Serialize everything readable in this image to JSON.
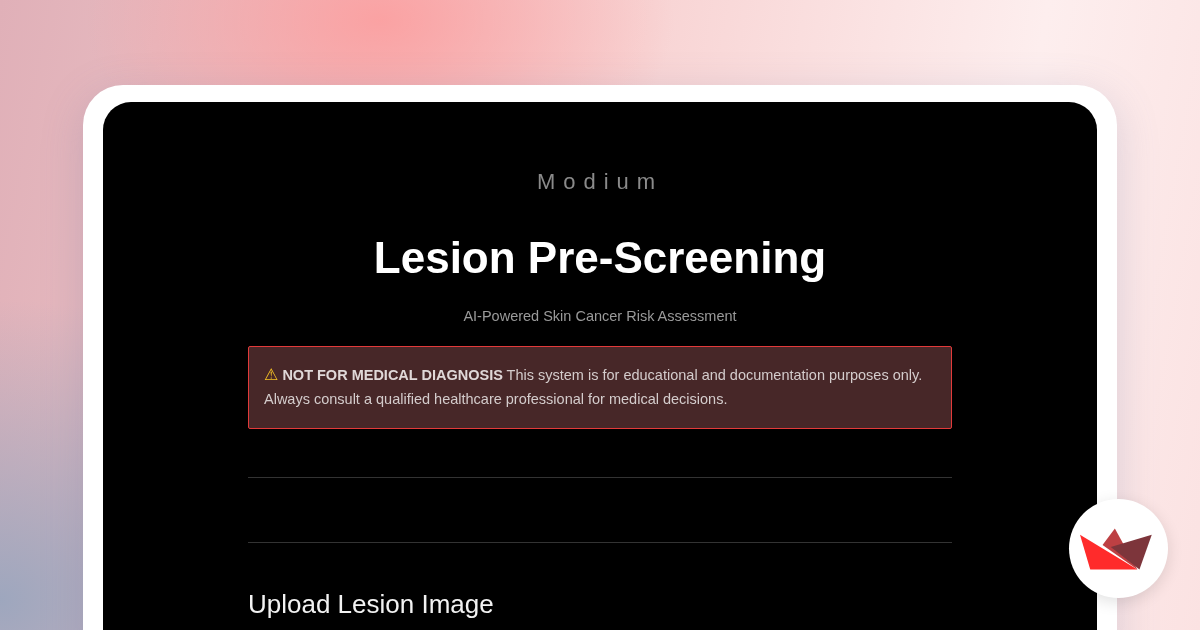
{
  "app": {
    "brand": "Modium",
    "title": "Lesion Pre-Screening",
    "subtitle": "AI-Powered Skin Cancer Risk Assessment"
  },
  "warning": {
    "icon": "⚠",
    "text": "**NOT FOR MEDICAL DIAGNOSIS** This system is for educational and documentation purposes only. Always consult a qualified healthcare professional for medical decisions."
  },
  "section": {
    "heading": "Upload Lesion Image"
  }
}
